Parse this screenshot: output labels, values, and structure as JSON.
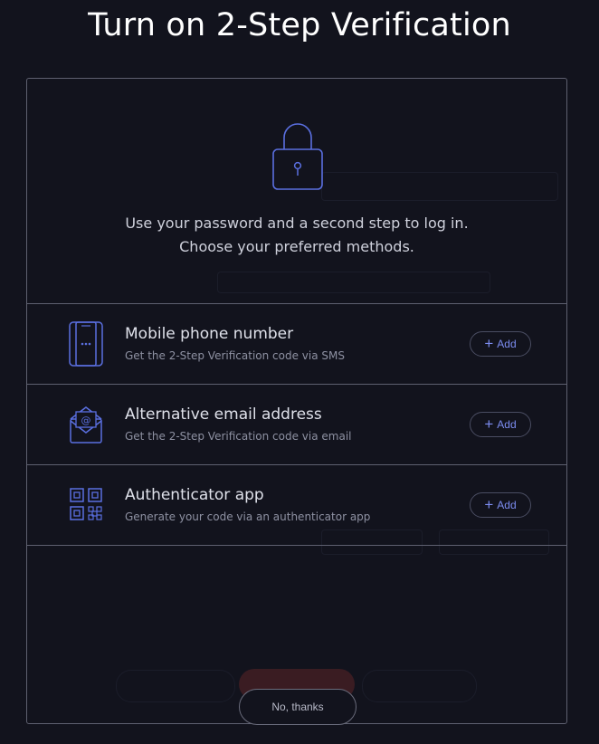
{
  "title": "Turn on 2-Step Verification",
  "hero": {
    "line1": "Use your password and a second step to log in.",
    "line2": "Choose your preferred methods."
  },
  "methods": [
    {
      "title": "Mobile phone number",
      "description": "Get the 2-Step Verification code via SMS",
      "icon": "mobile-phone-icon",
      "add_label": "Add"
    },
    {
      "title": "Alternative email address",
      "description": "Get the 2-Step Verification code via email",
      "icon": "envelope-icon",
      "add_label": "Add"
    },
    {
      "title": "Authenticator app",
      "description": "Generate your code via an authenticator app",
      "icon": "qr-code-icon",
      "add_label": "Add"
    }
  ],
  "dismiss_label": "No, thanks",
  "colors": {
    "accent": "#7c8cf0",
    "icon": "#5a6fe0",
    "background": "#12131d",
    "border": "#5e6070"
  }
}
